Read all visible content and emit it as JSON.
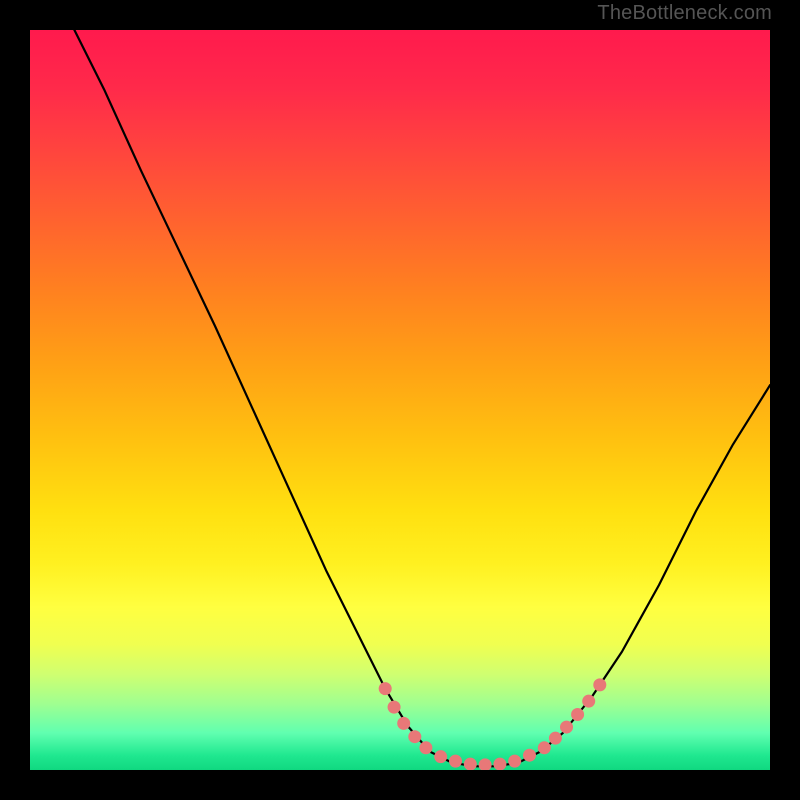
{
  "watermark": "TheBottleneck.com",
  "chart_data": {
    "type": "line",
    "title": "",
    "xlabel": "",
    "ylabel": "",
    "xlim": [
      0,
      100
    ],
    "ylim": [
      0,
      100
    ],
    "grid": false,
    "legend": false,
    "curve": [
      {
        "x": 6,
        "y": 100
      },
      {
        "x": 10,
        "y": 92
      },
      {
        "x": 15,
        "y": 81
      },
      {
        "x": 20,
        "y": 70.5
      },
      {
        "x": 25,
        "y": 60
      },
      {
        "x": 30,
        "y": 49
      },
      {
        "x": 35,
        "y": 38
      },
      {
        "x": 40,
        "y": 27
      },
      {
        "x": 45,
        "y": 17
      },
      {
        "x": 48,
        "y": 11
      },
      {
        "x": 51,
        "y": 6
      },
      {
        "x": 54,
        "y": 2.5
      },
      {
        "x": 57,
        "y": 1
      },
      {
        "x": 60,
        "y": 0.5
      },
      {
        "x": 63,
        "y": 0.5
      },
      {
        "x": 66,
        "y": 1
      },
      {
        "x": 69,
        "y": 2.5
      },
      {
        "x": 72,
        "y": 5
      },
      {
        "x": 76,
        "y": 10
      },
      {
        "x": 80,
        "y": 16
      },
      {
        "x": 85,
        "y": 25
      },
      {
        "x": 90,
        "y": 35
      },
      {
        "x": 95,
        "y": 44
      },
      {
        "x": 100,
        "y": 52
      }
    ],
    "markers": [
      {
        "x": 48,
        "y": 11
      },
      {
        "x": 49.2,
        "y": 8.5
      },
      {
        "x": 50.5,
        "y": 6.3
      },
      {
        "x": 52,
        "y": 4.5
      },
      {
        "x": 53.5,
        "y": 3
      },
      {
        "x": 55.5,
        "y": 1.8
      },
      {
        "x": 57.5,
        "y": 1.2
      },
      {
        "x": 59.5,
        "y": 0.8
      },
      {
        "x": 61.5,
        "y": 0.7
      },
      {
        "x": 63.5,
        "y": 0.8
      },
      {
        "x": 65.5,
        "y": 1.2
      },
      {
        "x": 67.5,
        "y": 2
      },
      {
        "x": 69.5,
        "y": 3
      },
      {
        "x": 71,
        "y": 4.3
      },
      {
        "x": 72.5,
        "y": 5.8
      },
      {
        "x": 74,
        "y": 7.5
      },
      {
        "x": 75.5,
        "y": 9.3
      },
      {
        "x": 77,
        "y": 11.5
      }
    ],
    "marker_color": "#e87878",
    "line_color": "#000000"
  }
}
